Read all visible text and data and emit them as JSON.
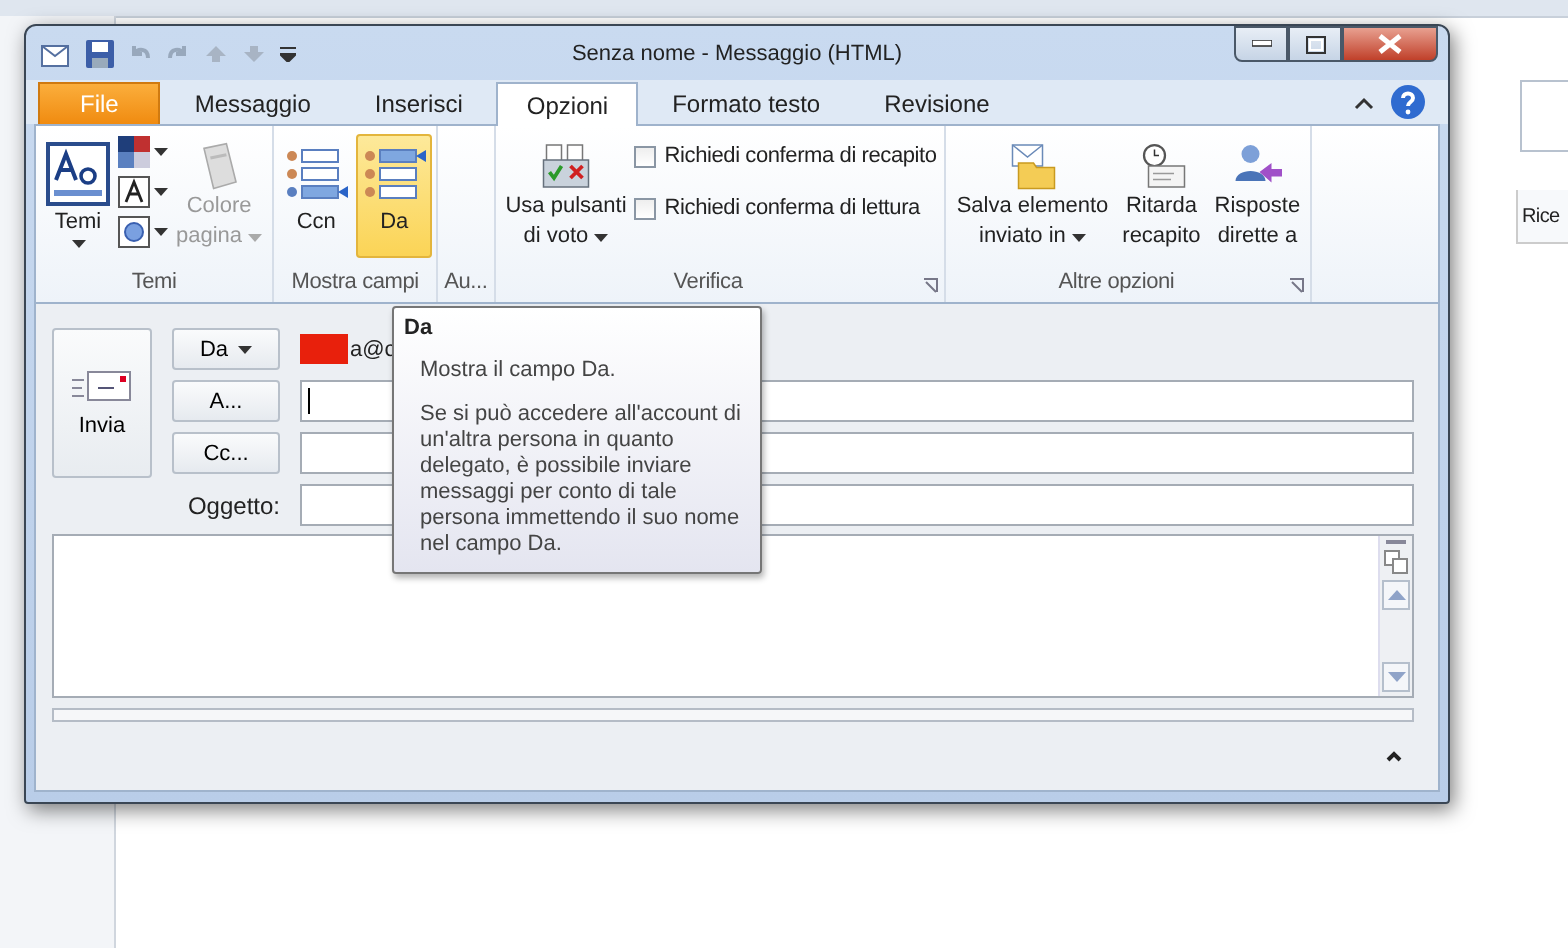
{
  "background_app": {
    "column_header": "Rice"
  },
  "window": {
    "title": "Senza nome  -  Messaggio (HTML)"
  },
  "tabs": [
    {
      "label": "File",
      "kind": "file",
      "selected": false
    },
    {
      "label": "Messaggio",
      "kind": "tab",
      "selected": false
    },
    {
      "label": "Inserisci",
      "kind": "tab",
      "selected": false
    },
    {
      "label": "Opzioni",
      "kind": "tab",
      "selected": true
    },
    {
      "label": "Formato testo",
      "kind": "tab",
      "selected": false
    },
    {
      "label": "Revisione",
      "kind": "tab",
      "selected": false
    }
  ],
  "ribbon": {
    "groups": [
      {
        "label": "Temi",
        "launcher": false,
        "buttons": [
          {
            "lines": [
              "Temi"
            ],
            "dropdown": true,
            "disabled": false,
            "selected": false
          },
          {
            "lines": [
              "Colore",
              "pagina"
            ],
            "dropdown": true,
            "disabled": true,
            "selected": false
          }
        ]
      },
      {
        "label": "Mostra campi",
        "launcher": false,
        "buttons": [
          {
            "lines": [
              "Ccn"
            ],
            "dropdown": false,
            "disabled": false,
            "selected": false
          },
          {
            "lines": [
              "Da"
            ],
            "dropdown": false,
            "disabled": false,
            "selected": true
          }
        ]
      },
      {
        "label": "Au...",
        "launcher": false
      },
      {
        "label": "Verifica",
        "launcher": true,
        "buttons": [
          {
            "lines": [
              "Usa pulsanti",
              "di voto"
            ],
            "dropdown": true,
            "disabled": false,
            "selected": false
          }
        ],
        "checkboxes": [
          {
            "label": "Richiedi conferma di recapito",
            "checked": false
          },
          {
            "label": "Richiedi conferma di lettura",
            "checked": false
          }
        ]
      },
      {
        "label": "Altre opzioni",
        "launcher": true,
        "buttons": [
          {
            "lines": [
              "Salva elemento",
              "inviato in"
            ],
            "dropdown": true,
            "disabled": false,
            "selected": false
          },
          {
            "lines": [
              "Ritarda",
              "recapito"
            ],
            "dropdown": false,
            "disabled": false,
            "selected": false
          },
          {
            "lines": [
              "Risposte",
              "dirette a"
            ],
            "dropdown": false,
            "disabled": false,
            "selected": false
          }
        ]
      }
    ]
  },
  "form": {
    "send_button": {
      "label": "Invia"
    },
    "address_buttons": [
      {
        "label": "Da",
        "dropdown": true
      },
      {
        "label": "A...",
        "dropdown": false
      },
      {
        "label": "Cc...",
        "dropdown": false
      }
    ],
    "from": {
      "value": "a@c",
      "redacted": true
    },
    "to": {
      "focused": true
    },
    "subject_label": "Oggetto:"
  },
  "tooltip": {
    "title": "Da",
    "paragraphs": [
      "Mostra il campo Da.",
      "Se si può accedere all'account di un'altra persona in quanto delegato, è possibile inviare messaggi per conto di tale persona immettendo il suo nome nel campo Da."
    ]
  }
}
